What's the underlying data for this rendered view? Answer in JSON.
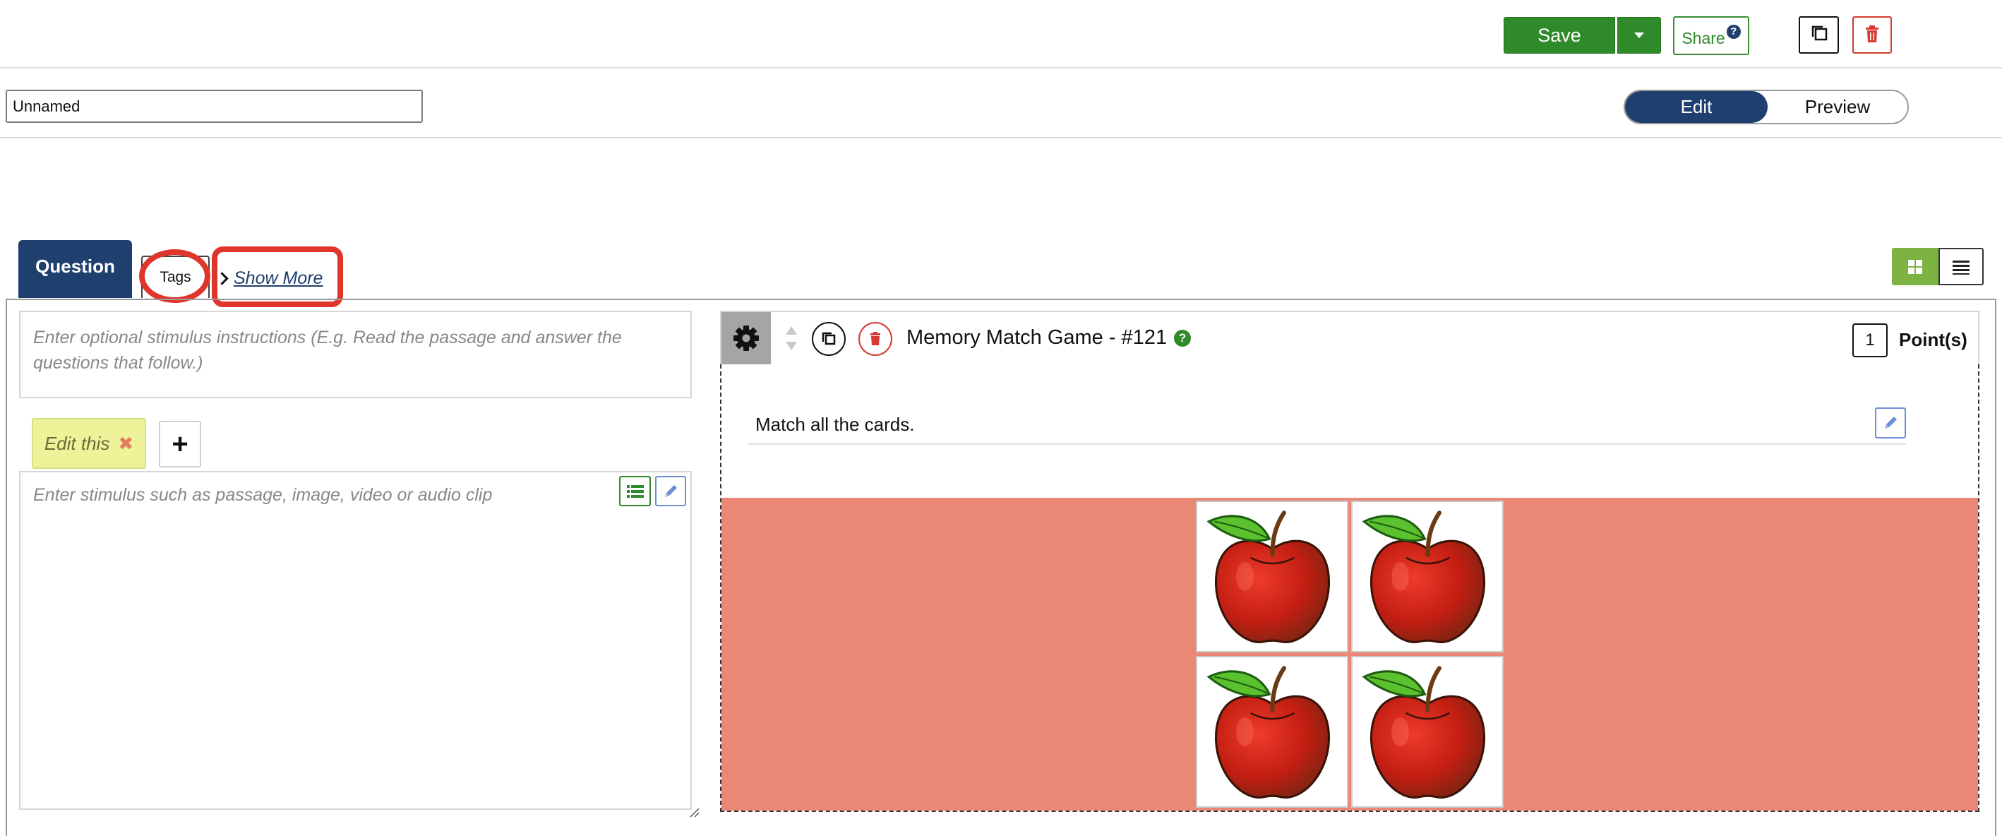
{
  "toolbar": {
    "save_label": "Save",
    "share_label": "Share",
    "share_help": "?"
  },
  "header": {
    "title_value": "Unnamed",
    "mode_edit": "Edit",
    "mode_preview": "Preview"
  },
  "tabs": {
    "question": "Question",
    "tags": "Tags",
    "show_more": "Show More"
  },
  "left": {
    "instructions_placeholder": "Enter optional stimulus instructions (E.g. Read the passage and answer the questions that follow.)",
    "edit_tab_label": "Edit this",
    "stimulus_placeholder": "Enter stimulus such as passage, image, video or audio clip"
  },
  "question": {
    "title": "Memory Match Game - #121",
    "help": "?",
    "points_value": "1",
    "points_label": "Point(s)",
    "prompt": "Match all the cards."
  },
  "colors": {
    "primary_navy": "#1f3f6e",
    "save_green": "#2f8a2a",
    "delete_red": "#d43a2f",
    "board_salmon": "#eb8776",
    "annotation_red": "#e0352b",
    "edit_tab_yellow": "#eef39a"
  },
  "icons": [
    "caret-down-icon",
    "help-icon",
    "copy-icon",
    "trash-icon",
    "chevron-right-icon",
    "grid-view-icon",
    "list-view-icon",
    "close-icon",
    "plus-icon",
    "list-icon",
    "pencil-icon",
    "gear-icon",
    "sort-icon",
    "apple-icon"
  ]
}
